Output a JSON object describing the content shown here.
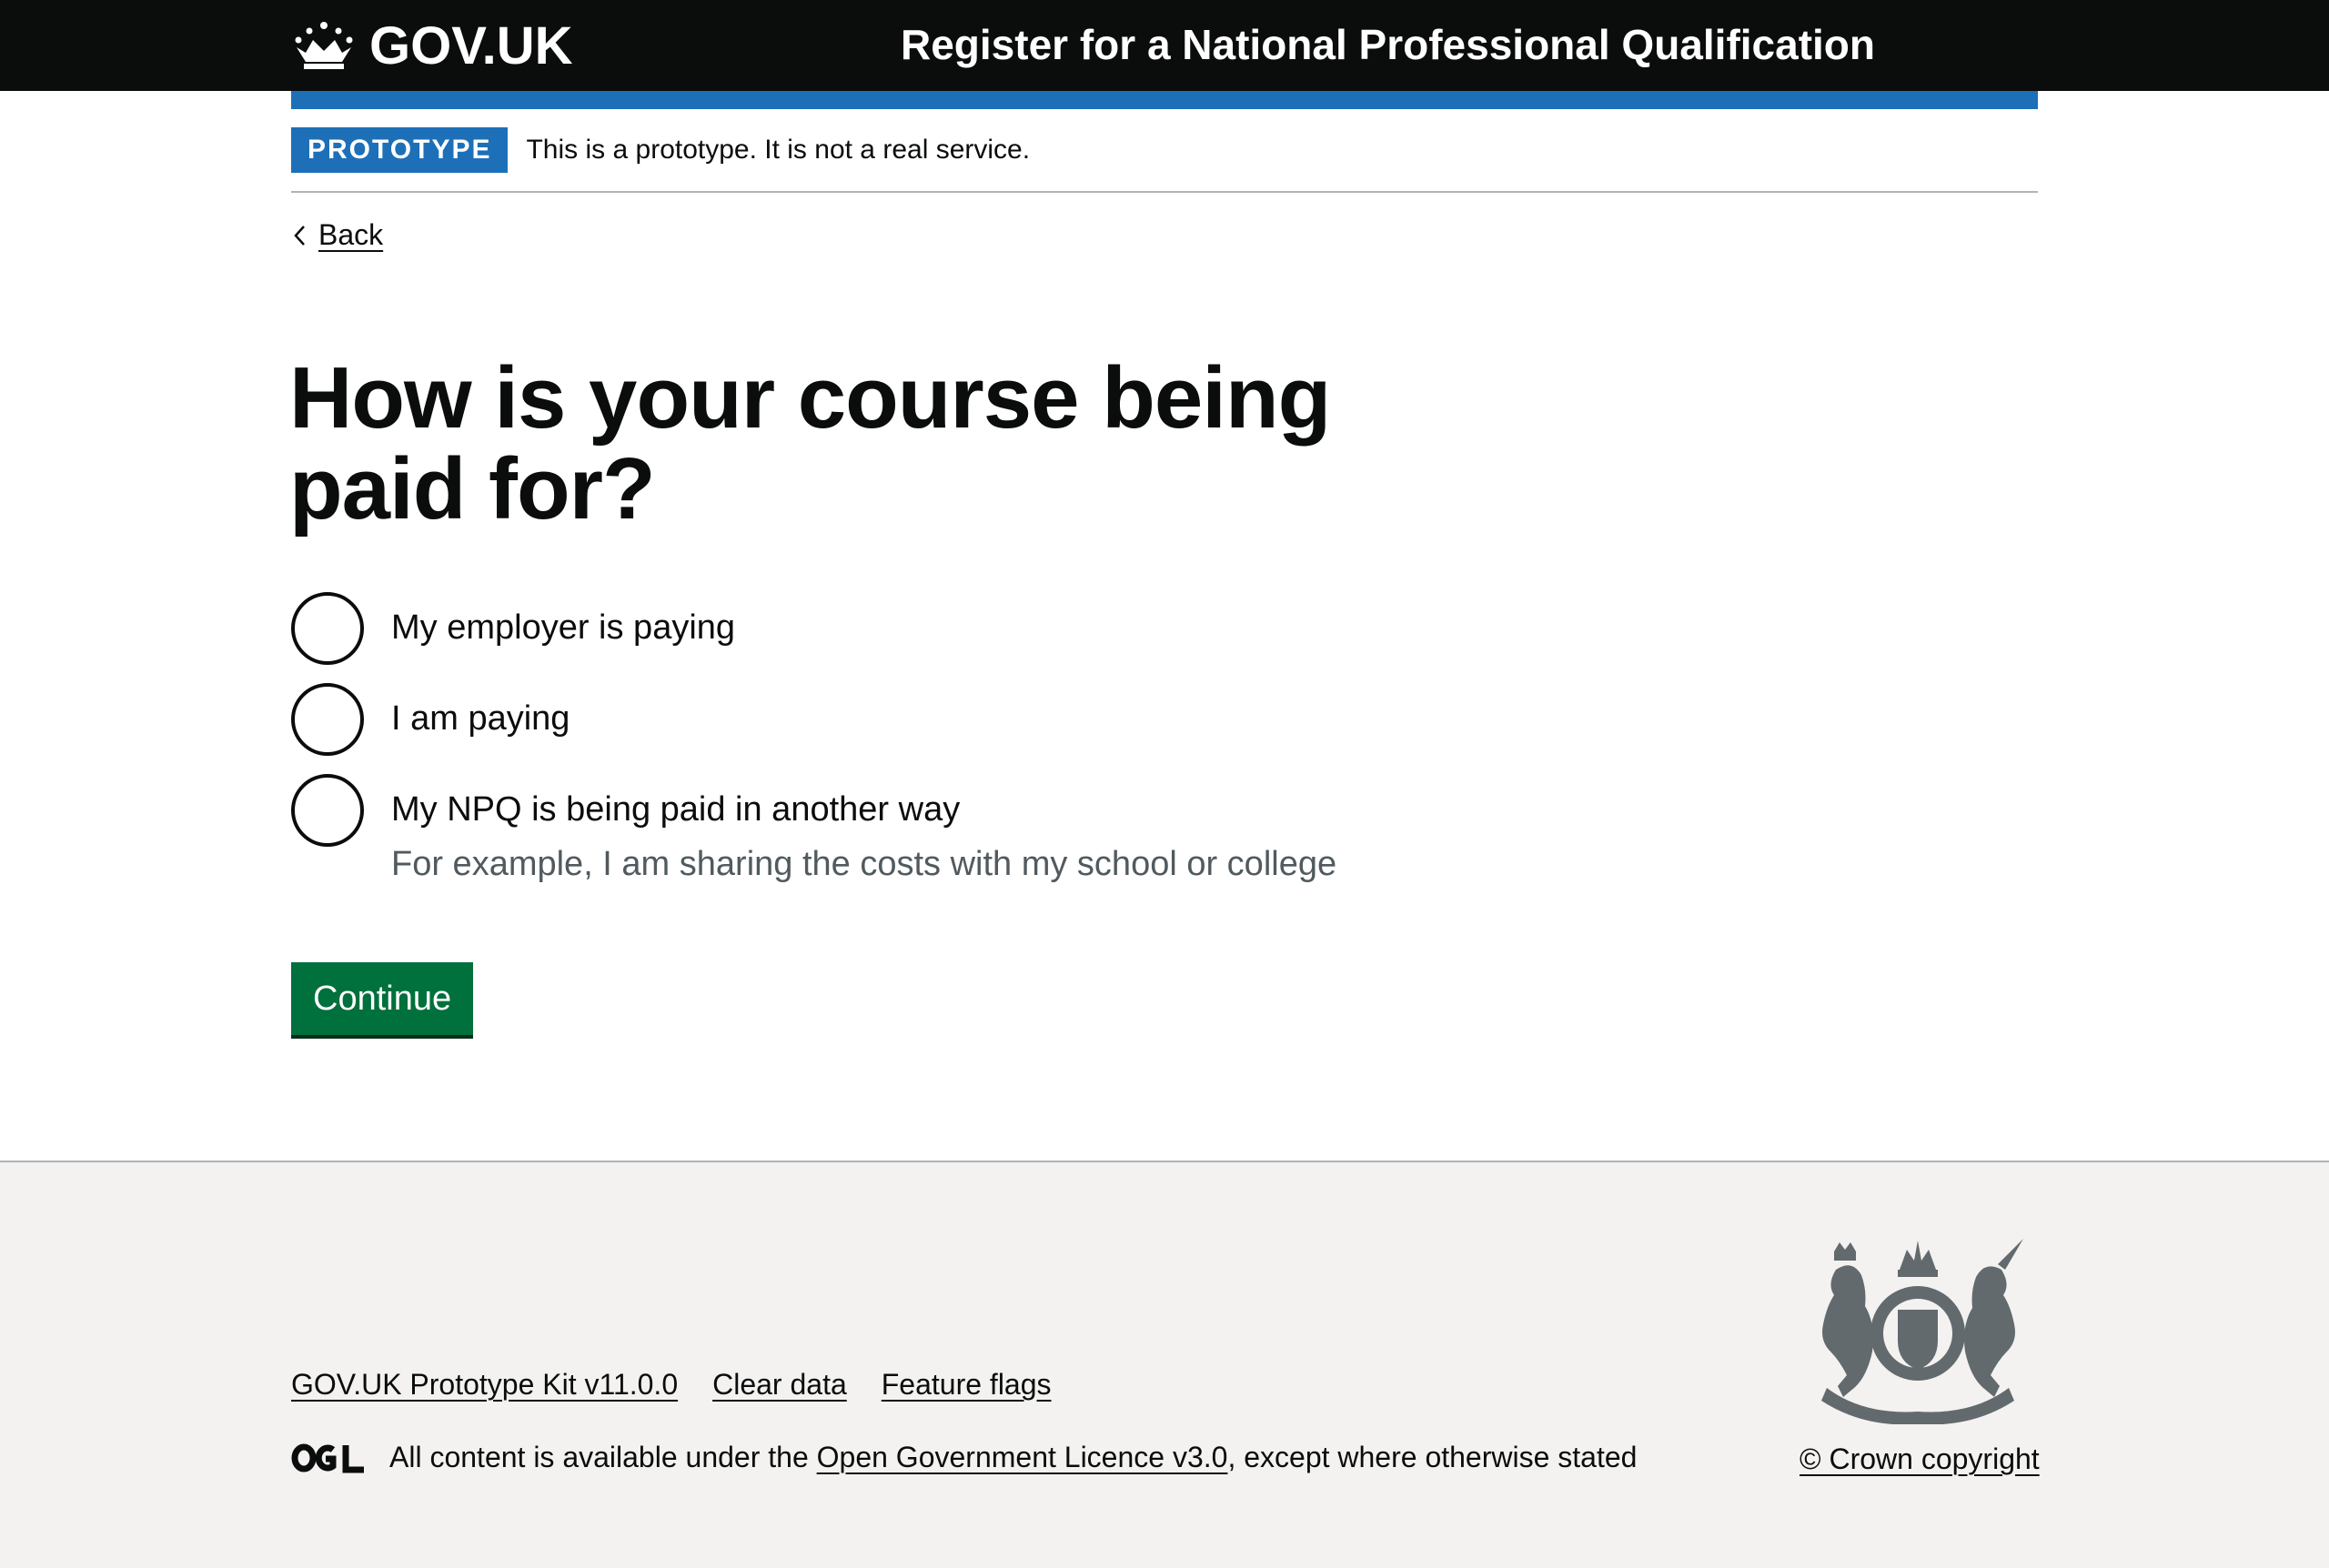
{
  "header": {
    "logo_text": "GOV.UK",
    "service_name": "Register for a National Professional Qualification"
  },
  "phase_banner": {
    "tag": "PROTOTYPE",
    "text": "This is a prototype. It is not a real service."
  },
  "back_link": {
    "label": "Back"
  },
  "question": {
    "heading": "How is your course being paid for?",
    "options": [
      {
        "label": "My employer is paying",
        "hint": ""
      },
      {
        "label": "I am paying",
        "hint": ""
      },
      {
        "label": "My NPQ is being paid in another way",
        "hint": "For example, I am sharing the costs with my school or college"
      }
    ]
  },
  "continue_button": {
    "label": "Continue"
  },
  "footer": {
    "links": [
      "GOV.UK Prototype Kit v11.0.0",
      "Clear data",
      "Feature flags"
    ],
    "licence_prefix": "All content is available under the ",
    "licence_link": "Open Government Licence v3.0",
    "licence_suffix": ", except where otherwise stated",
    "copyright": "© Crown copyright"
  },
  "colors": {
    "header_bg": "#0b0c0c",
    "brand_blue": "#1d70b8",
    "button_green": "#00703c",
    "footer_bg": "#f3f2f1",
    "hint_grey": "#505a5f"
  }
}
